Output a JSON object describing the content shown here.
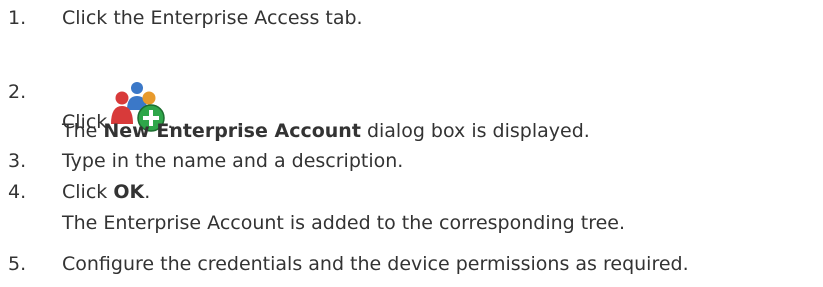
{
  "steps": [
    {
      "num": "1.",
      "text": "Click the Enterprise Access tab."
    },
    {
      "num": "2.",
      "text": "Click",
      "after": ".",
      "icon": "add-enterprise-account-icon",
      "result": {
        "pre": "The ",
        "bold": "New Enterprise Account",
        "post": " dialog box is displayed."
      }
    },
    {
      "num": "3.",
      "text": "Type in the name and a description."
    },
    {
      "num": "4.",
      "text": "Click ",
      "bold": "OK",
      "after": ".",
      "result": {
        "text": "The Enterprise Account is added to the corresponding tree."
      }
    },
    {
      "num": "5.",
      "text": "Configure the credentials and the device permissions as required."
    }
  ],
  "colors": {
    "text": "#333333",
    "icon_red": "#d83a3a",
    "icon_blue": "#3b78c8",
    "icon_green": "#2fa64a"
  }
}
